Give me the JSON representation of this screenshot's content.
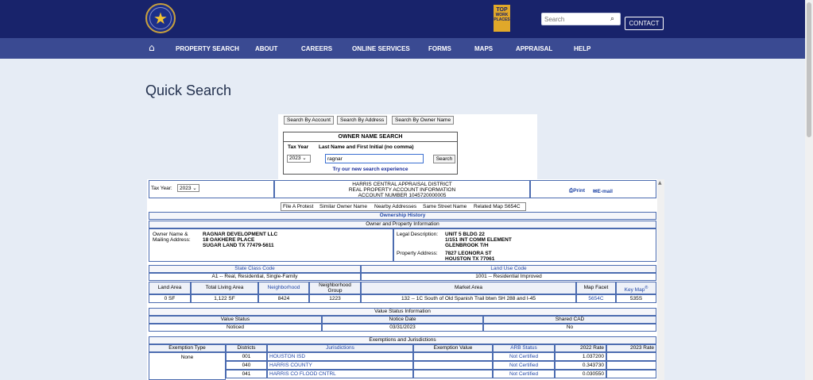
{
  "header": {
    "search_placeholder": "Search",
    "contact_label": "CONTACT",
    "badge_top": "TOP",
    "badge_lines": [
      "WORK",
      "PLACES"
    ],
    "nav": [
      "PROPERTY SEARCH",
      "ABOUT",
      "CAREERS",
      "ONLINE SERVICES",
      "FORMS",
      "MAPS",
      "APPRAISAL",
      "HELP"
    ]
  },
  "page": {
    "title": "Quick Search"
  },
  "quick_search": {
    "tabs": [
      "Search By Account",
      "Search By Address",
      "Search By Owner Name"
    ],
    "box_title": "OWNER NAME SEARCH",
    "col_tax_year": "Tax Year",
    "col_name": "Last Name and First Initial (no comma)",
    "tax_year": "2023",
    "name_value": "ragnar",
    "search_label": "Search",
    "new_experience": "Try our new search experience"
  },
  "record": {
    "tax_year_label": "Tax Year:",
    "tax_year": "2023",
    "district": "HARRIS CENTRAL APPRAISAL DISTRICT",
    "subtitle": "REAL PROPERTY ACCOUNT INFORMATION",
    "account": "ACCOUNT NUMBER 1045720000005",
    "print_label": "Print",
    "email_label": "E-mail",
    "links": [
      "File A Protest",
      "Similar Owner Name",
      "Nearby Addresses",
      "Same Street Name",
      "Related Map S654C"
    ],
    "ownership_history": "Ownership History",
    "owner_section": "Owner and Property Information",
    "owner_label": "Owner Name &",
    "mailing_label": "Mailing Address:",
    "owner_lines": [
      "RAGNAR DEVELOPMENT LLC",
      "18 OAKHERE PLACE",
      "SUGAR LAND TX 77479-5611"
    ],
    "legal_label": "Legal Description:",
    "legal_lines": [
      "UNIT 5 BLDG 22",
      "1/151 INT COMM ELEMENT",
      "GLENBROOK T/H"
    ],
    "property_label": "Property Address:",
    "property_lines": [
      "7827 LEONORA ST",
      "HOUSTON TX 77061"
    ],
    "state_class_label": "State Class Code",
    "state_class_value": "A1 -- Real, Residential, Single-Family",
    "land_use_label": "Land Use Code",
    "land_use_value": "1001 -- Residential Improved",
    "land_cols": [
      "Land Area",
      "Total Living Area",
      "Neighborhood",
      "Neighborhood",
      "Group",
      "Market Area",
      "Map Facet",
      "Key Map",
      "®"
    ],
    "land_vals": [
      "0 SF",
      "1,122 SF",
      "8424",
      "1223",
      "132 -- 1C South of Old Spanish Trail btwn SH 288 and I-45",
      "5654C",
      "535S"
    ],
    "value_status_title": "Value Status Information",
    "vs_cols": [
      "Value Status",
      "Notice Date",
      "Shared CAD"
    ],
    "vs_vals": [
      "Noticed",
      "03/31/2023",
      "No"
    ],
    "exemptions_title": "Exemptions and Jurisdictions",
    "ex_cols": [
      "Exemption Type",
      "Districts",
      "Jurisdictions",
      "Exemption Value",
      "ARB Status",
      "2022 Rate",
      "2023 Rate"
    ],
    "ex_type": "None",
    "ex_rows": [
      {
        "district": "001",
        "jurisdiction": "HOUSTON ISD",
        "arb": "Not Certified",
        "rate": "1.037200"
      },
      {
        "district": "040",
        "jurisdiction": "HARRIS COUNTY",
        "arb": "Not Certified",
        "rate": "0.343730"
      },
      {
        "district": "041",
        "jurisdiction": "HARRIS CO FLOOD CNTRL",
        "arb": "Not Certified",
        "rate": "0.030550"
      }
    ]
  }
}
